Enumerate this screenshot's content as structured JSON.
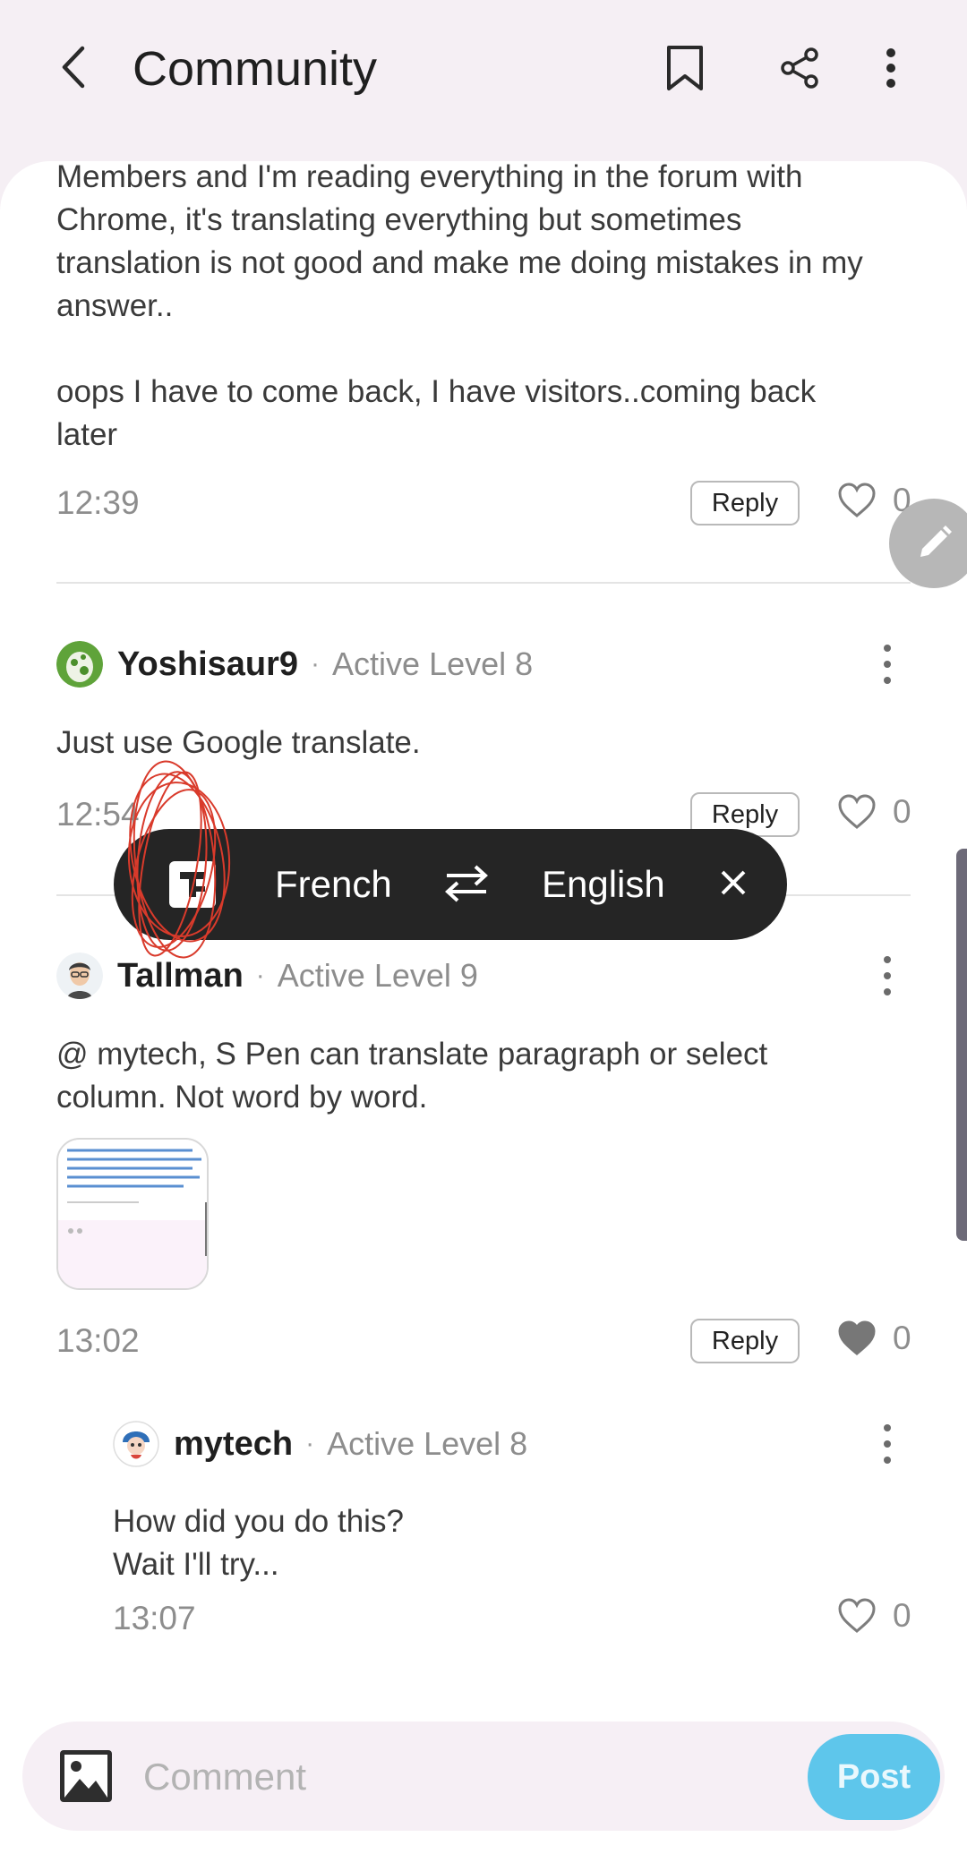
{
  "header": {
    "title": "Community",
    "back_icon": "arrow-back-icon",
    "bookmark_icon": "bookmark-icon",
    "share_icon": "share-icon",
    "more_icon": "more-vertical-icon"
  },
  "posts": [
    {
      "text_lines": [
        "Members and I'm reading everything in the forum with",
        "Chrome, it's translating everything but sometimes",
        "translation is not good and make me doing mistakes in my",
        "answer..",
        "",
        "oops I have to come back, I have visitors..coming back",
        "later"
      ],
      "time": "12:39",
      "reply": "Reply",
      "likes": "0"
    },
    {
      "user": "Yoshisaur9",
      "level": "Active Level 8",
      "text": "Just use Google translate.",
      "time": "12:54",
      "reply": "Reply",
      "likes": "0"
    },
    {
      "user": "Tallman",
      "level": "Active Level 9",
      "text_lines": [
        "@ mytech, S Pen can translate paragraph or select",
        "column. Not word by word."
      ],
      "time": "13:02",
      "reply": "Reply",
      "likes": "0",
      "liked": true
    },
    {
      "user": "mytech",
      "level": "Active Level 8",
      "text_lines": [
        "How did you do this?",
        "Wait I'll try..."
      ],
      "time": "13:07",
      "likes": "0"
    }
  ],
  "separator": "·",
  "translate_bar": {
    "source": "French",
    "target": "English",
    "swap_icon": "swap-arrows-icon",
    "close_icon": "close-icon",
    "app_icon": "translate-icon"
  },
  "comment_box": {
    "placeholder": "Comment",
    "post_label": "Post",
    "image_icon": "image-icon"
  },
  "colors": {
    "accent": "#5ec6eb",
    "dark_bar": "#252525",
    "annotation": "#d93a2b"
  }
}
